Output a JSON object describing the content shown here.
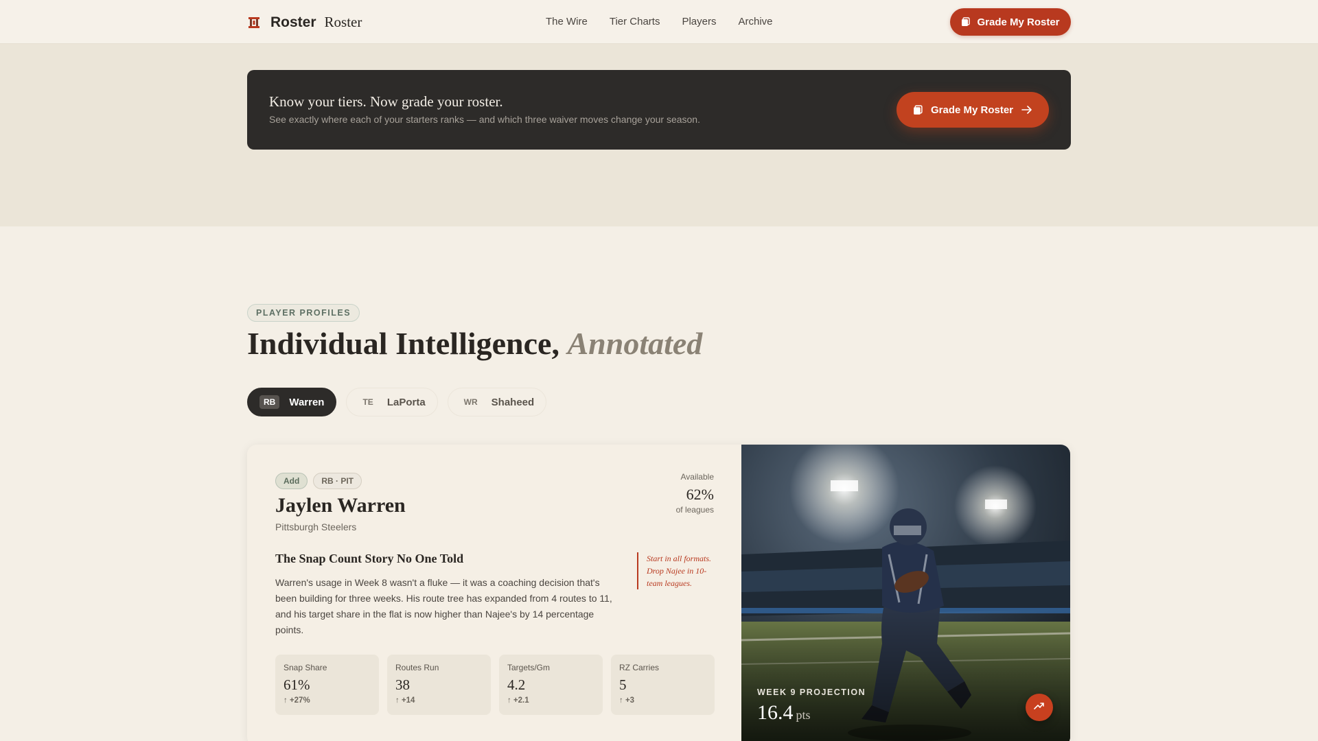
{
  "nav": {
    "brand_strong": "Roster",
    "brand_serif": "Roster",
    "links": [
      "The Wire",
      "Tier Charts",
      "Players",
      "Archive"
    ],
    "cta": "Grade My Roster"
  },
  "promo": {
    "title": "Know your tiers. Now grade your roster.",
    "subtitle": "See exactly where each of your starters ranks — and which three waiver moves change your season.",
    "cta": "Grade My Roster"
  },
  "section": {
    "tag": "PLAYER PROFILES",
    "title_main": "Individual Intelligence,",
    "title_accent": "Annotated"
  },
  "tabs": [
    {
      "pos": "RB",
      "name": "Warren"
    },
    {
      "pos": "TE",
      "name": "LaPorta"
    },
    {
      "pos": "WR",
      "name": "Shaheed"
    }
  ],
  "player": {
    "badge_add": "Add",
    "badge_team": "RB · PIT",
    "name": "Jaylen Warren",
    "team": "Pittsburgh Steelers",
    "available_label": "Available",
    "available_pct": "62%",
    "available_sub": "of leagues",
    "story_title": "The Snap Count Story No One Told",
    "story_body": "Warren's usage in Week 8 wasn't a fluke — it was a coaching decision that's been building for three weeks. His route tree has expanded from 4 routes to 11, and his target share in the flat is now higher than Najee's by 14 percentage points.",
    "note": "Start in all formats. Drop Najee in 10-team leagues.",
    "stats": [
      {
        "label": "Snap Share",
        "value": "61%",
        "delta": "↑ +27%"
      },
      {
        "label": "Routes Run",
        "value": "38",
        "delta": "↑ +14"
      },
      {
        "label": "Targets/Gm",
        "value": "4.2",
        "delta": "↑ +2.1"
      },
      {
        "label": "RZ Carries",
        "value": "5",
        "delta": "↑ +3"
      }
    ],
    "projection_label": "WEEK 9 PROJECTION",
    "projection_value": "16.4",
    "projection_unit": "pts"
  },
  "colors": {
    "accent": "#b8391f",
    "dark": "#2d2b29",
    "background": "#f4efe6"
  },
  "icons": [
    "roster-logo-icon",
    "clipboard-icon",
    "arrow-right-icon",
    "trending-up-icon"
  ]
}
